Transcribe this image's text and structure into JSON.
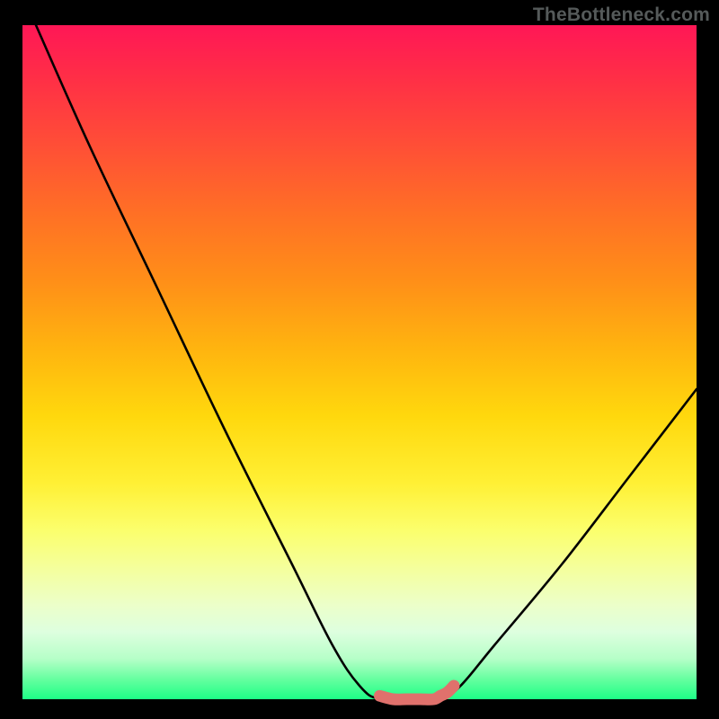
{
  "watermark": "TheBottleneck.com",
  "chart_data": {
    "type": "line",
    "title": "",
    "xlabel": "",
    "ylabel": "",
    "xlim": [
      0,
      100
    ],
    "ylim": [
      0,
      100
    ],
    "grid": false,
    "series": [
      {
        "name": "main-curve",
        "color": "#000000",
        "x": [
          2,
          10,
          20,
          30,
          40,
          46,
          50,
          53,
          58,
          62,
          65,
          70,
          80,
          90,
          100
        ],
        "y": [
          100,
          82,
          61,
          40,
          20,
          8,
          2,
          0,
          0,
          0,
          2,
          8,
          20,
          33,
          46
        ]
      },
      {
        "name": "flat-highlight",
        "color": "#e0716c",
        "x": [
          53,
          55,
          57,
          59,
          61,
          62,
          63,
          64
        ],
        "y": [
          0.5,
          0,
          0,
          0,
          0,
          0.5,
          1,
          2
        ]
      }
    ],
    "colors": {
      "gradient_top": "#ff1756",
      "gradient_bottom": "#1dff86",
      "frame": "#000000"
    }
  }
}
